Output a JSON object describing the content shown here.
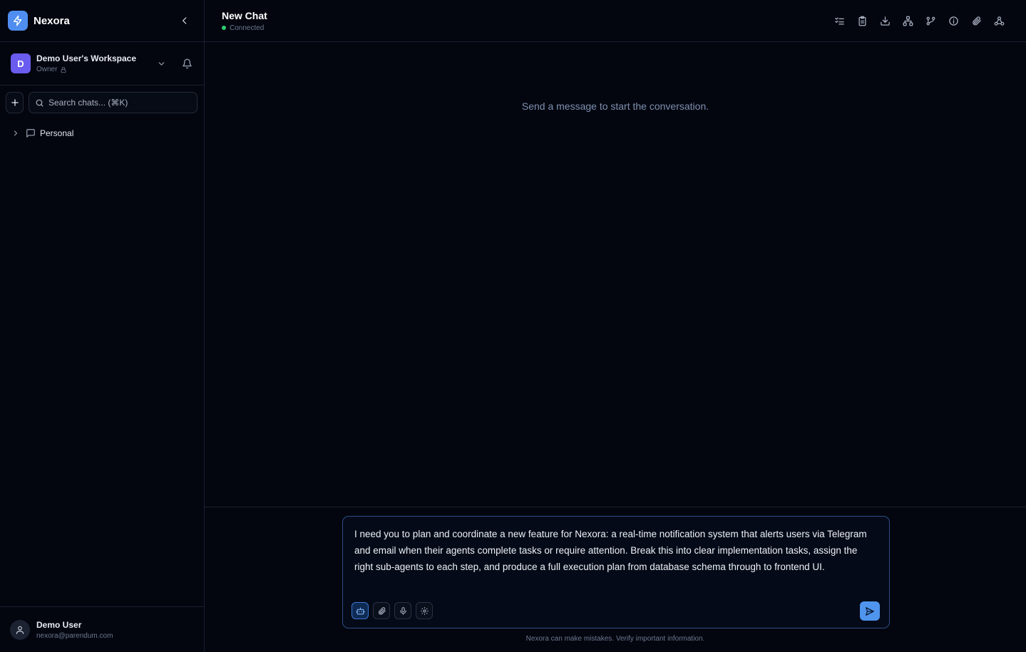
{
  "brand": {
    "name": "Nexora",
    "color": "#4f8ef0"
  },
  "workspace": {
    "avatar_letter": "D",
    "name": "Demo User's Workspace",
    "role": "Owner"
  },
  "search": {
    "placeholder": "Search chats... (⌘K)"
  },
  "folders": [
    {
      "label": "Personal"
    }
  ],
  "user": {
    "name": "Demo User",
    "email": "nexora@parendum.com"
  },
  "chat": {
    "title": "New Chat",
    "status": "Connected",
    "status_color": "#2ecc71"
  },
  "toolbar_icons": [
    "task-list-icon",
    "clipboard-icon",
    "download-icon",
    "sitemap-icon",
    "branch-icon",
    "info-icon",
    "paperclip-icon",
    "webhook-icon"
  ],
  "empty_state": "Send a message to start the conversation.",
  "composer": {
    "text": "I need you to plan and coordinate a new feature for Nexora: a real-time notification system that alerts users via Telegram and email when their agents complete tasks or require attention. Break this into clear implementation tasks, assign the right sub-agents to each step, and produce a full execution plan from database schema through to frontend UI.",
    "tools": [
      "agent-icon",
      "paperclip-icon",
      "microphone-icon",
      "settings-icon"
    ]
  },
  "disclaimer": "Nexora can make mistakes. Verify important information."
}
